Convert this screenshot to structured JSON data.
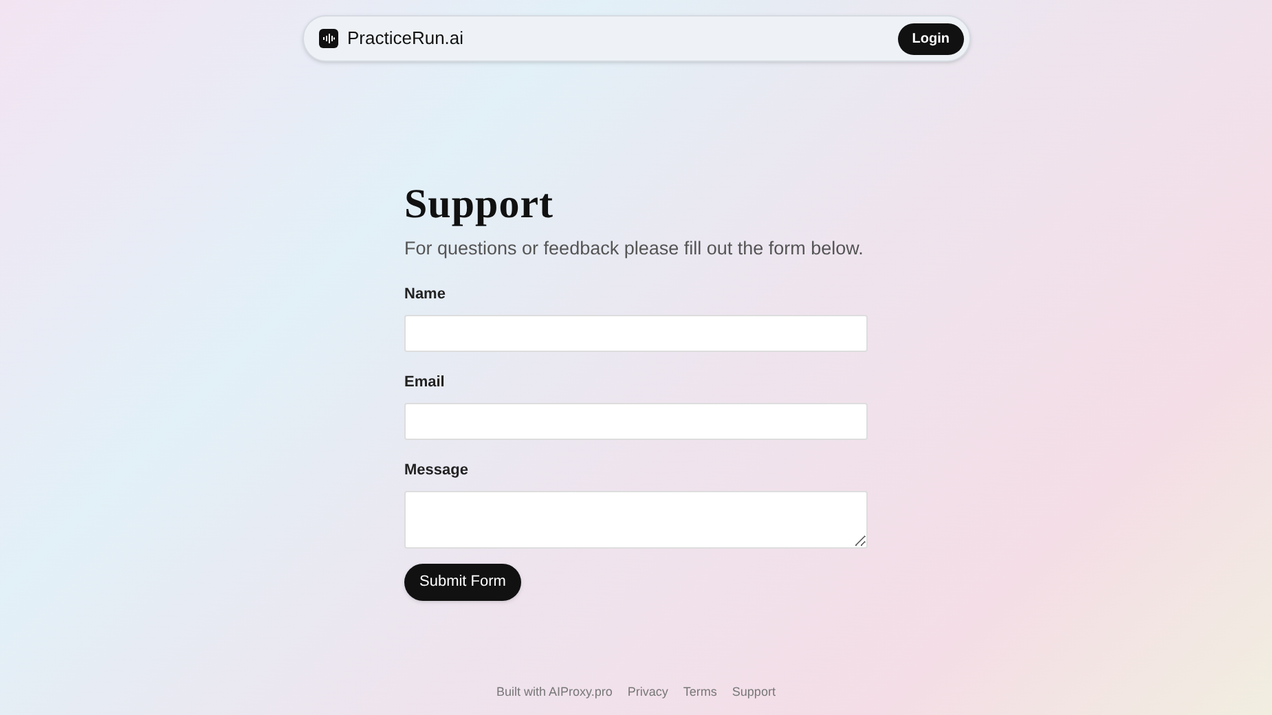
{
  "navbar": {
    "brand": "PracticeRun.ai",
    "login_button": "Login"
  },
  "page": {
    "title": "Support",
    "subtitle": "For questions or feedback please fill out the form below."
  },
  "form": {
    "fields": [
      {
        "label": "Name",
        "kind": "text"
      },
      {
        "label": "Email",
        "kind": "text"
      },
      {
        "label": "Message",
        "kind": "textarea"
      }
    ],
    "submit_button": "Submit Form"
  },
  "footer": {
    "links": [
      "Built with AIProxy.pro",
      "Privacy",
      "Terms",
      "Support"
    ]
  }
}
